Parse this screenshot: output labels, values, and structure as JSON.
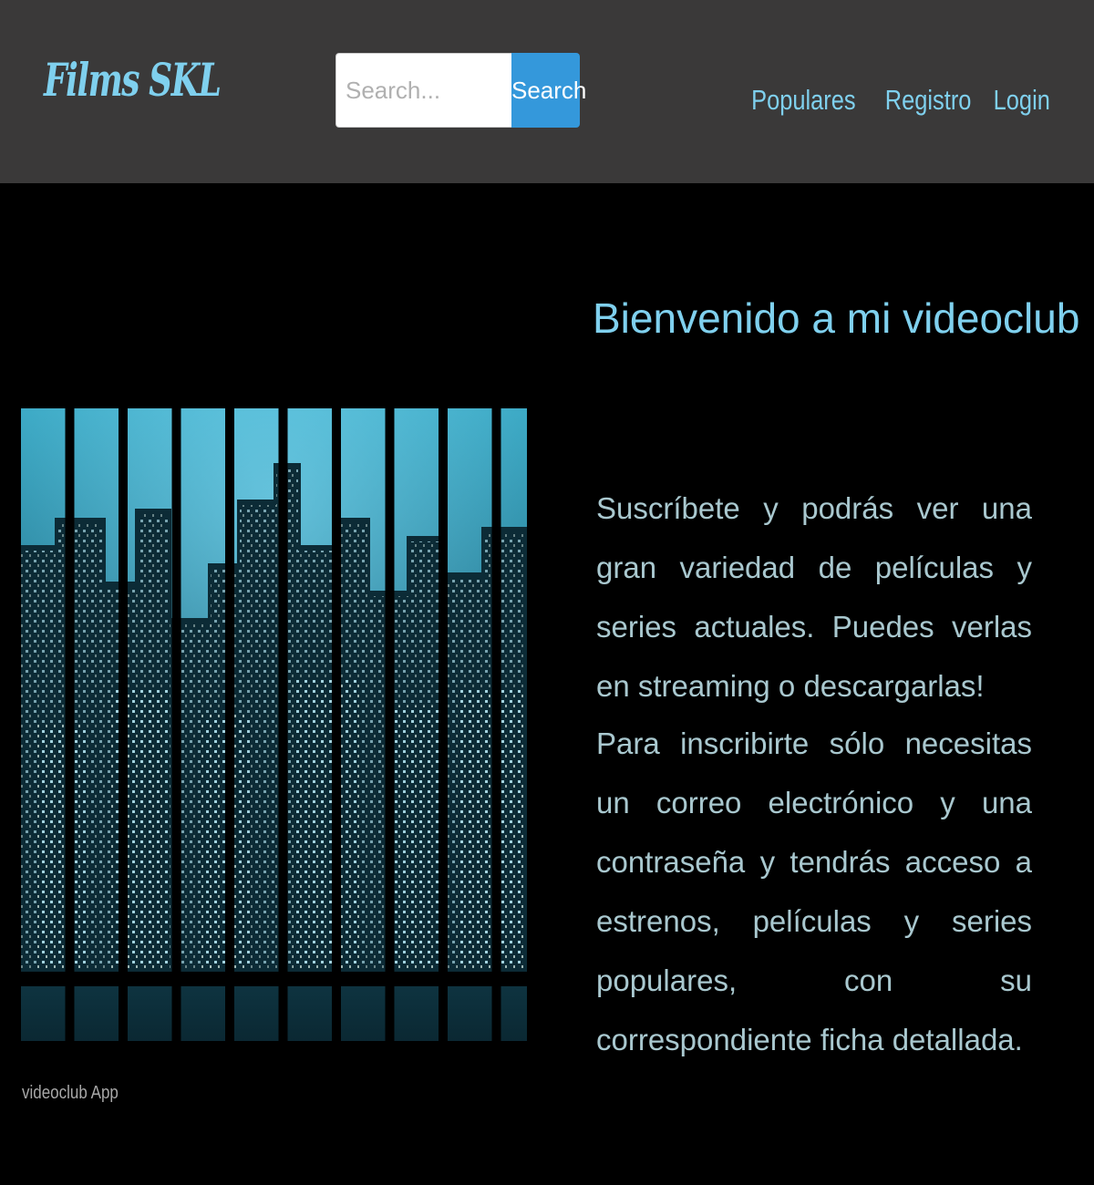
{
  "brand": {
    "logo": "Films SKL",
    "accent_color": "#7fd0ee",
    "navbar_color": "#3a3939"
  },
  "search": {
    "placeholder": "Search...",
    "value": "",
    "button_label": "Search",
    "button_color": "#3498db"
  },
  "nav": {
    "items": [
      {
        "label": "Populares"
      },
      {
        "label": "Registro"
      },
      {
        "label": "Login"
      }
    ]
  },
  "main": {
    "title": "Bienvenido a mi videoclub",
    "paragraphs": [
      "Suscríbete y podrás ver una gran variedad de películas y series actuales. Puedes verlas en streaming o descargarlas!",
      "Para inscribirte sólo necesitas un correo electrónico y una contraseña y tendrás acceso a estrenos, películas y series populares, con su correspondiente ficha detallada."
    ],
    "image_alt": "city skyline at night seen through window panes",
    "caption": "videoclub App"
  }
}
